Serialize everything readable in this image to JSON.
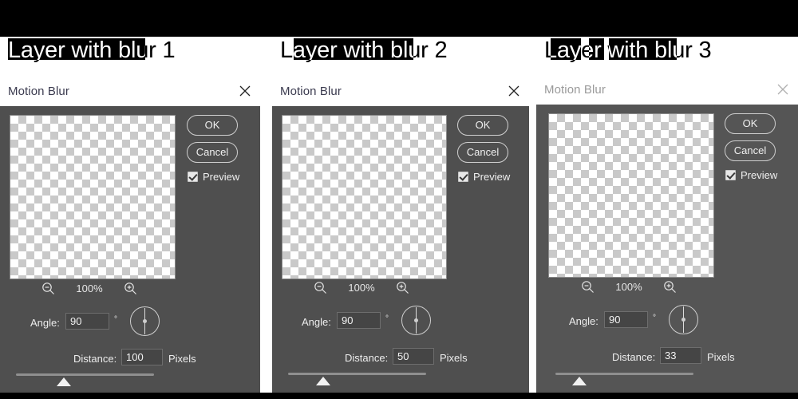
{
  "screen": {
    "background_top_band": "#000000",
    "page_background": "#ffffff",
    "dialog_background": "#4f4f4f",
    "accent_text": "#3b3b4f"
  },
  "panels": [
    {
      "layer_title": "Layer with blur 1",
      "dialog": {
        "title": "Motion Blur",
        "close_icon": "close-icon",
        "ok_label": "OK",
        "cancel_label": "Cancel",
        "preview_label": "Preview",
        "preview_checked": true,
        "zoom_out_icon": "zoom-out-icon",
        "zoom_in_icon": "zoom-in-icon",
        "zoom_level": "100%",
        "angle_label": "Angle:",
        "angle_value": "90",
        "degree_symbol": "°",
        "distance_label": "Distance:",
        "distance_value": "100",
        "distance_units": "Pixels",
        "slider_percent": 35
      }
    },
    {
      "layer_title": "Layer with blur 2",
      "dialog": {
        "title": "Motion Blur",
        "close_icon": "close-icon",
        "ok_label": "OK",
        "cancel_label": "Cancel",
        "preview_label": "Preview",
        "preview_checked": true,
        "zoom_out_icon": "zoom-out-icon",
        "zoom_in_icon": "zoom-in-icon",
        "zoom_level": "100%",
        "angle_label": "Angle:",
        "angle_value": "90",
        "degree_symbol": "°",
        "distance_label": "Distance:",
        "distance_value": "50",
        "distance_units": "Pixels",
        "slider_percent": 22
      }
    },
    {
      "layer_title": "Layer with blur 3",
      "dialog": {
        "title": "Motion Blur",
        "close_icon": "close-icon",
        "ok_label": "OK",
        "cancel_label": "Cancel",
        "preview_label": "Preview",
        "preview_checked": true,
        "zoom_out_icon": "zoom-out-icon",
        "zoom_in_icon": "zoom-in-icon",
        "zoom_level": "100%",
        "angle_label": "Angle:",
        "angle_value": "90",
        "degree_symbol": "°",
        "distance_label": "Distance:",
        "distance_value": "33",
        "distance_units": "Pixels",
        "slider_percent": 15
      }
    }
  ]
}
